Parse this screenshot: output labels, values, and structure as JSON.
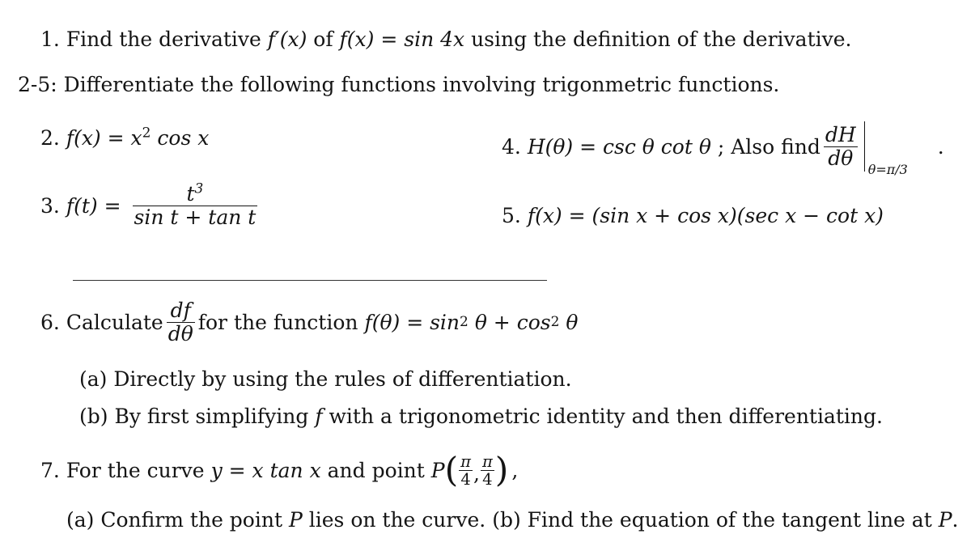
{
  "problems": {
    "p1": {
      "number": "1.",
      "text_a": "Find the derivative",
      "fprime": "f′(x)",
      "text_b": "of",
      "func": "f(x) = sin 4x",
      "text_c": "using the definition of the derivative."
    },
    "section_2_5": {
      "label": "2-5:",
      "text": "Differentiate the following functions involving trigonmetric functions."
    },
    "p2": {
      "number": "2.",
      "lhs": "f(x) =",
      "rhs_base": "x",
      "rhs_exp": "2",
      "rhs_tail": "cos x"
    },
    "p3": {
      "number": "3.",
      "lhs": "f(t) =",
      "numerator_base": "t",
      "numerator_exp": "3",
      "denominator": "sin t + tan t"
    },
    "p4": {
      "number": "4.",
      "lhs": "H(θ) =",
      "rhs": "csc θ cot θ",
      "sep": ";",
      "also": "Also find",
      "deriv_num": "dH",
      "deriv_den": "dθ",
      "eval_at": "θ=π/3",
      "period": "."
    },
    "p5": {
      "number": "5.",
      "expr": "f(x) = (sin x + cos x)(sec x − cot x)"
    },
    "p6": {
      "number": "6.",
      "text_a": "Calculate",
      "deriv_num": "df",
      "deriv_den": "dθ",
      "text_b": "for the function",
      "func_lhs": "f(θ) = sin",
      "exp1": "2",
      "mid": "θ + cos",
      "exp2": "2",
      "tail": "θ",
      "part_a": "(a) Directly by using the rules of differentiation.",
      "part_b_1": "(b) By first simplifying",
      "part_b_f": "f",
      "part_b_2": "with a trigonometric identity and then differentiating."
    },
    "p7": {
      "number": "7.",
      "text_a": "For the curve",
      "curve": "y = x tan x",
      "text_b": "and point",
      "point": "P",
      "coord_num1": "π",
      "coord_den1": "4",
      "coord_num2": "π",
      "coord_den2": "4",
      "comma": ",",
      "part_a_1": "(a) Confirm the point",
      "part_a_p": "P",
      "part_a_2": "lies on the curve.",
      "part_b_1": "(b) Find the equation of the tangent line at",
      "part_b_p": "P",
      "part_b_end": "."
    }
  }
}
